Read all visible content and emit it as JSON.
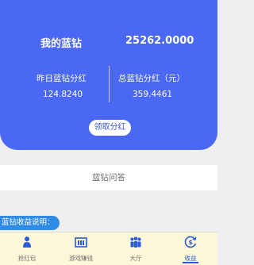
{
  "card": {
    "title": "我的蓝钻",
    "balance": "25262.0000",
    "yesterday_label": "昨日蓝钻分红",
    "yesterday_value": "124.8240",
    "total_label": "总蓝钻分红（元）",
    "total_value": "359.4461",
    "claim_button": "领取分红"
  },
  "faq_label": "蓝钻问答",
  "info_label": "蓝钻收益说明：",
  "tabs": [
    {
      "label": "抢红包",
      "icon": "person-icon"
    },
    {
      "label": "游戏赚钱",
      "icon": "game-icon"
    },
    {
      "label": "大厅",
      "icon": "group-icon"
    },
    {
      "label": "收益",
      "icon": "earnings-icon"
    }
  ],
  "colors": {
    "card_bg": "#4a68f3",
    "accent": "#2a5bd8",
    "info_pill": "#2f8be6",
    "tabbar_bg": "#fdf7d9"
  },
  "active_tab": "收益"
}
